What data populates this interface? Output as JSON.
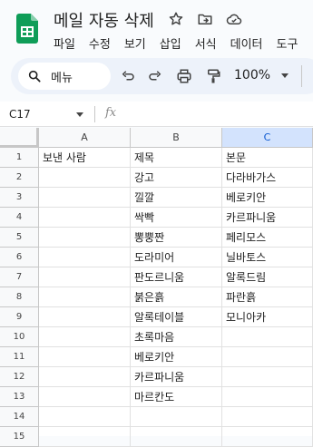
{
  "app": {
    "title": "메일 자동 삭제",
    "menus": [
      "파일",
      "수정",
      "보기",
      "삽입",
      "서식",
      "데이터",
      "도구"
    ]
  },
  "toolbar": {
    "search_label": "메뉴",
    "zoom": "100%"
  },
  "formula_bar": {
    "name_box": "C17",
    "fx_label": "fx",
    "value": ""
  },
  "sheet": {
    "selected_column": "C",
    "columns": [
      "A",
      "B",
      "C"
    ],
    "rows": [
      {
        "num": "1",
        "cells": [
          "보낸 사람",
          "제목",
          "본문"
        ]
      },
      {
        "num": "2",
        "cells": [
          "",
          "강고",
          "다라바가스"
        ]
      },
      {
        "num": "3",
        "cells": [
          "",
          "낄깔",
          "베로키안"
        ]
      },
      {
        "num": "4",
        "cells": [
          "",
          "싹빡",
          "카르파니움"
        ]
      },
      {
        "num": "5",
        "cells": [
          "",
          "뽕뿡짠",
          "페리모스"
        ]
      },
      {
        "num": "6",
        "cells": [
          "",
          "도라미어",
          "닐바토스"
        ]
      },
      {
        "num": "7",
        "cells": [
          "",
          "판도르니움",
          "알록드림"
        ]
      },
      {
        "num": "8",
        "cells": [
          "",
          "붉은흙",
          "파란흙"
        ]
      },
      {
        "num": "9",
        "cells": [
          "",
          "알록테이블",
          "모니아카"
        ]
      },
      {
        "num": "10",
        "cells": [
          "",
          "초록마음",
          ""
        ]
      },
      {
        "num": "11",
        "cells": [
          "",
          "베로키안",
          ""
        ]
      },
      {
        "num": "12",
        "cells": [
          "",
          "카르파니움",
          ""
        ]
      },
      {
        "num": "13",
        "cells": [
          "",
          "마르칸도",
          ""
        ]
      },
      {
        "num": "14",
        "cells": [
          "",
          "",
          ""
        ]
      },
      {
        "num": "15",
        "cells": [
          "",
          "",
          ""
        ]
      }
    ]
  },
  "colors": {
    "brand_green": "#0f9d58",
    "selected_header": "#d3e3fd",
    "toolbar_bg": "#edf2fa"
  }
}
